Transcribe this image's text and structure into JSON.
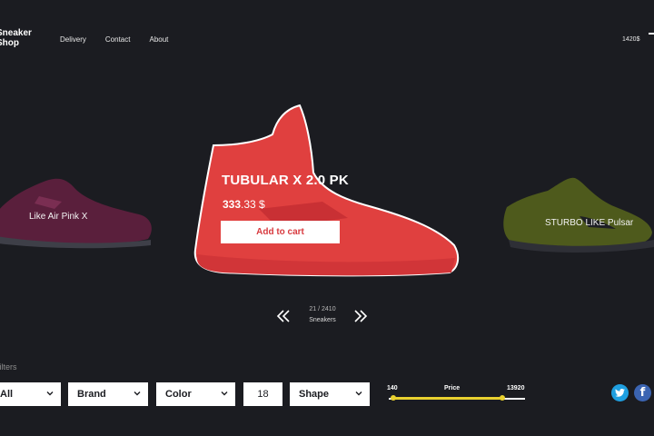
{
  "brand": {
    "logo_line1": "Sneaker",
    "logo_line2": "Shop"
  },
  "nav": {
    "items": [
      "Delivery",
      "Contact",
      "About"
    ]
  },
  "header": {
    "cart_total": "1420$"
  },
  "carousel": {
    "prev_item": {
      "label": "Like Air Pink X"
    },
    "current": {
      "name": "TUBULAR X 2.0 PK",
      "price_major": "333",
      "price_minor": ".33 $",
      "add_to_cart": "Add to cart",
      "color": "#e0403f"
    },
    "next_item": {
      "label": "STURBO LIKE Pulsar"
    },
    "counter": "21 / 2410",
    "category": "Sneakers"
  },
  "filters": {
    "title": "Filters",
    "selects": {
      "all": "All",
      "brand": "Brand",
      "color": "Color",
      "size": "18",
      "shape": "Shape"
    },
    "price": {
      "label": "Price",
      "min": "140",
      "max": "13920",
      "range_start": 0.03,
      "range_end": 0.83
    }
  },
  "colors": {
    "background": "#1b1c21",
    "accent_red": "#e0403f",
    "slider": "#e9d12f",
    "twitter": "#1f9fe0",
    "facebook": "#3b64b2"
  },
  "icons": [
    "menu-icon",
    "chevron-down-icon",
    "double-chevron-left-icon",
    "double-chevron-right-icon",
    "twitter-icon",
    "facebook-icon"
  ]
}
